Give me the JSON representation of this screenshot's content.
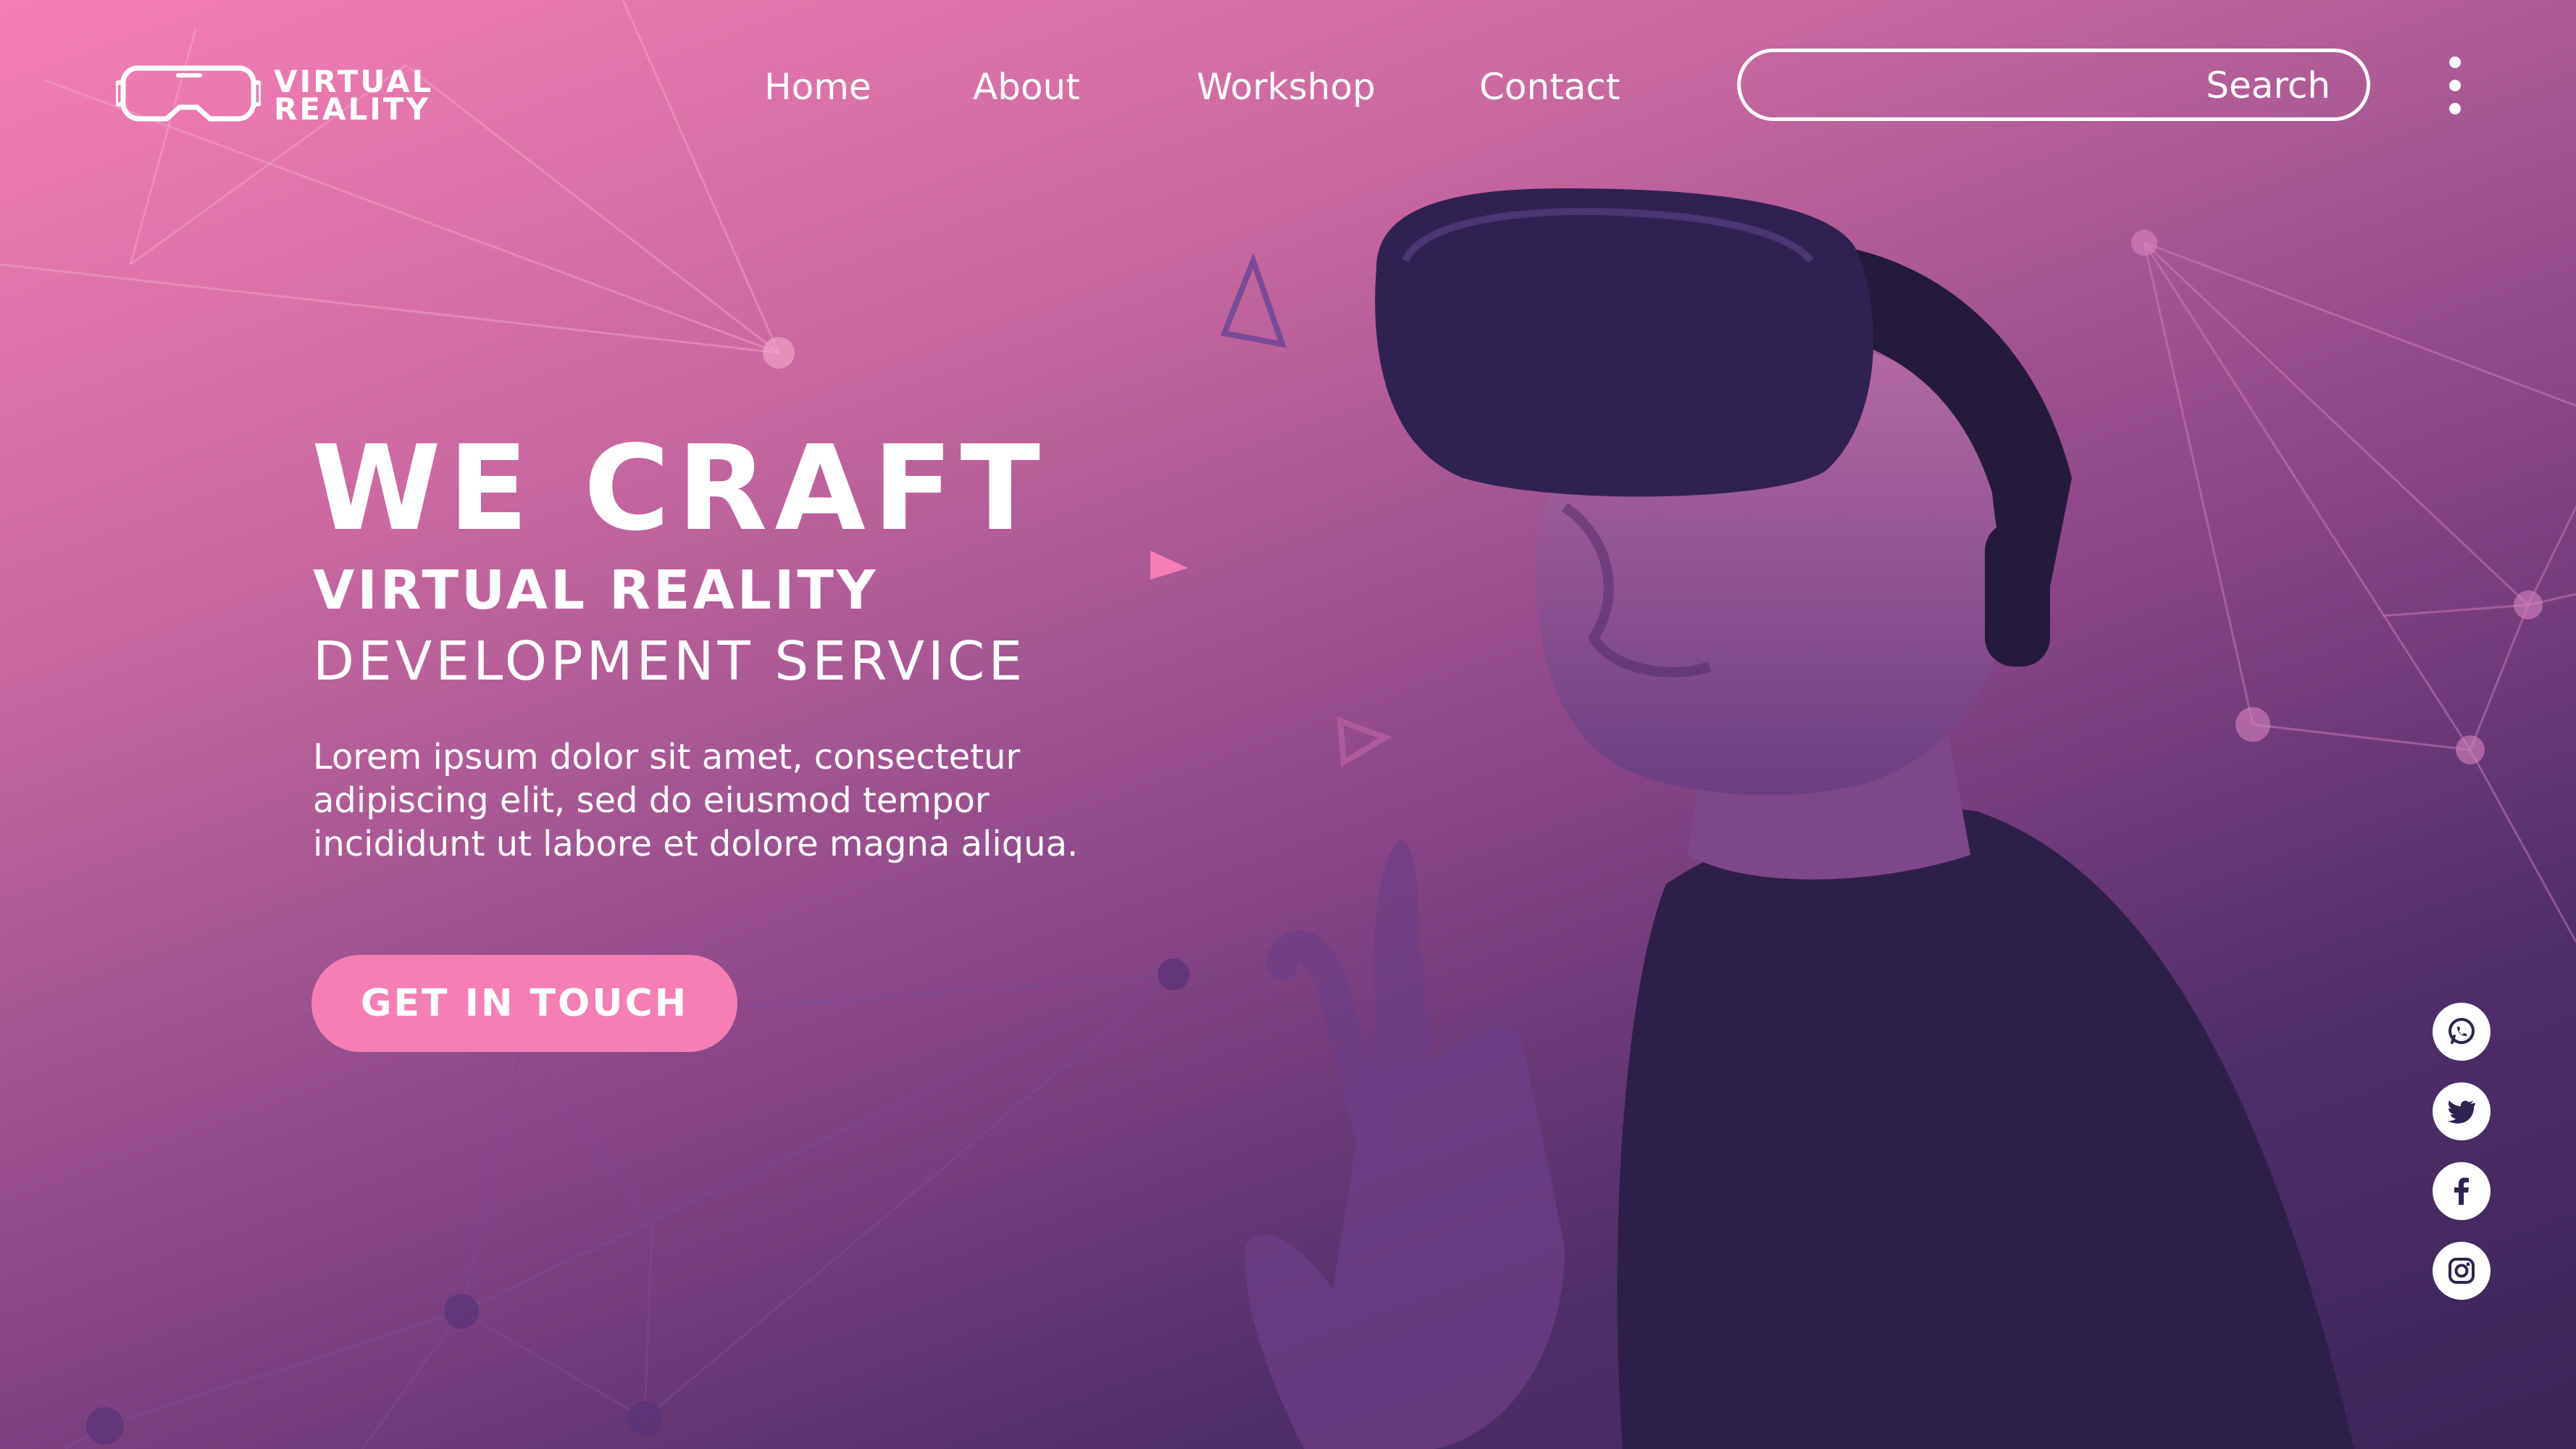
{
  "brand": {
    "line1": "VIRTUAL",
    "line2": "REALITY",
    "icon": "vr-headset-icon"
  },
  "nav": {
    "items": [
      {
        "label": "Home"
      },
      {
        "label": "About"
      },
      {
        "label": "Workshop"
      },
      {
        "label": "Contact"
      }
    ]
  },
  "search": {
    "label": "Search"
  },
  "menu": {
    "icon": "kebab-menu-icon"
  },
  "hero": {
    "title": "WE CRAFT",
    "subtitle_bold": "VIRTUAL REALITY",
    "subtitle_light": "DEVELOPMENT SERVICE",
    "body": "Lorem ipsum dolor sit amet, consectetur adipiscing elit, sed do eiusmod tempor incididunt ut labore et dolore magna aliqua.",
    "cta_label": "GET IN TOUCH"
  },
  "social": [
    {
      "icon": "whatsapp-icon"
    },
    {
      "icon": "twitter-icon"
    },
    {
      "icon": "facebook-icon"
    },
    {
      "icon": "instagram-icon"
    }
  ],
  "colors": {
    "accent": "#f57fb4",
    "dark": "#3a2556",
    "icon_fg": "#2f2250"
  }
}
